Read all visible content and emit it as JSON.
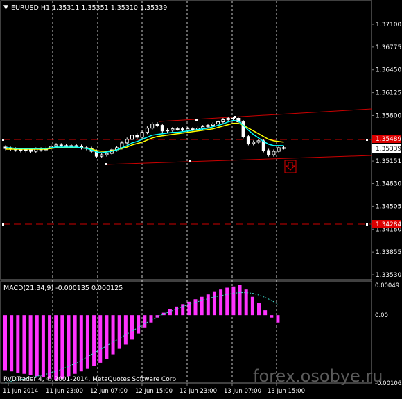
{
  "symbol_header": "EURUSD,H1  1.35311 1.35351 1.35310 1.35339",
  "price_axis": {
    "ticks": [
      "1.37100",
      "1.36775",
      "1.36450",
      "1.36125",
      "1.35800",
      "1.35489",
      "1.35339",
      "1.35151",
      "1.34830",
      "1.34505",
      "1.34180",
      "1.33855",
      "1.33530"
    ],
    "range": [
      1.3353,
      1.3718
    ],
    "current_price_label": "1.35339",
    "marker_label": "1.35489",
    "bottom_marker_label": "1.34284"
  },
  "indicator": {
    "label": "MACD(21,34,9) -0.000135 0.000125",
    "axis_ticks": [
      "0.00049",
      "0.00",
      "-0.001065"
    ]
  },
  "time_axis": [
    "11 Jun 2014",
    "11 Jun 23:00",
    "12 Jun 07:00",
    "12 Jun 15:00",
    "12 Jun 23:00",
    "13 Jun 07:00",
    "13 Jun 15:00"
  ],
  "copyright": "RVDTrader 4, © 2001-2014, MetaQuotes Software Corp.",
  "watermark": "forex.osobye.ru",
  "colors": {
    "background": "#000000",
    "axis_text": "#ffffff",
    "candle": "#ffffff",
    "channel": "#cc0000",
    "ma_yellow": "#ffff00",
    "ma_cyan": "#00ffff",
    "macd_hist": "#ff33ff",
    "signal": "#40e0d0",
    "marker_red": "#dd0000"
  },
  "chart_data": {
    "type": "line",
    "series_candles": {
      "open": [
        1.3535,
        1.3533,
        1.3532,
        1.3531,
        1.353,
        1.3531,
        1.3529,
        1.3532,
        1.3531,
        1.3533,
        1.3536,
        1.3538,
        1.3537,
        1.3536,
        1.3537,
        1.3536,
        1.3534,
        1.3533,
        1.3529,
        1.3522,
        1.3524,
        1.3526,
        1.3531,
        1.3534,
        1.3541,
        1.3546,
        1.3552,
        1.3549,
        1.3556,
        1.3562,
        1.3568,
        1.3566,
        1.3558,
        1.3559,
        1.3561,
        1.3561,
        1.3559,
        1.3561,
        1.356,
        1.3562,
        1.3564,
        1.3566,
        1.3568,
        1.3571,
        1.3574,
        1.3576,
        1.3576,
        1.3571,
        1.355,
        1.354,
        1.3542,
        1.3544,
        1.353,
        1.3524,
        1.3529,
        1.3534
      ],
      "close": [
        1.3533,
        1.3532,
        1.3531,
        1.353,
        1.3531,
        1.3529,
        1.3532,
        1.3531,
        1.3533,
        1.3536,
        1.3538,
        1.3537,
        1.3536,
        1.3537,
        1.3536,
        1.3534,
        1.3533,
        1.3529,
        1.3522,
        1.3524,
        1.3526,
        1.3531,
        1.3534,
        1.3541,
        1.3546,
        1.3552,
        1.3549,
        1.3556,
        1.3562,
        1.3568,
        1.3566,
        1.3558,
        1.3559,
        1.3561,
        1.3561,
        1.3559,
        1.3561,
        1.356,
        1.3562,
        1.3564,
        1.3566,
        1.3568,
        1.3571,
        1.3574,
        1.3576,
        1.3576,
        1.3571,
        1.355,
        1.354,
        1.3542,
        1.3544,
        1.353,
        1.3524,
        1.3529,
        1.3534,
        1.3534
      ]
    },
    "ma_yellow": [
      1.3532,
      1.3532,
      1.3532,
      1.3532,
      1.3532,
      1.3532,
      1.3532,
      1.3532,
      1.3532,
      1.3533,
      1.3534,
      1.3534,
      1.3534,
      1.3534,
      1.3534,
      1.3534,
      1.3533,
      1.3532,
      1.353,
      1.3529,
      1.3529,
      1.353,
      1.3531,
      1.3533,
      1.3535,
      1.3538,
      1.354,
      1.3542,
      1.3545,
      1.3548,
      1.355,
      1.3551,
      1.3552,
      1.3553,
      1.3554,
      1.3555,
      1.3556,
      1.3557,
      1.3558,
      1.3559,
      1.356,
      1.3561,
      1.3563,
      1.3565,
      1.3567,
      1.3569,
      1.3569,
      1.3566,
      1.3562,
      1.3558,
      1.3554,
      1.355,
      1.3546,
      1.3544,
      1.3543,
      1.3542
    ],
    "ma_cyan": [
      1.3534,
      1.3534,
      1.3533,
      1.3533,
      1.3533,
      1.3533,
      1.3533,
      1.3533,
      1.3533,
      1.3534,
      1.3535,
      1.3535,
      1.3535,
      1.3535,
      1.3535,
      1.3534,
      1.3533,
      1.3531,
      1.3528,
      1.3527,
      1.3528,
      1.3529,
      1.3531,
      1.3534,
      1.3537,
      1.3541,
      1.3543,
      1.3546,
      1.3549,
      1.3552,
      1.3553,
      1.3554,
      1.3555,
      1.3556,
      1.3556,
      1.3557,
      1.3558,
      1.3559,
      1.356,
      1.3561,
      1.3562,
      1.3564,
      1.3566,
      1.3568,
      1.3571,
      1.3573,
      1.3572,
      1.3566,
      1.3559,
      1.3553,
      1.3548,
      1.3543,
      1.3539,
      1.3537,
      1.3537,
      1.3537
    ],
    "macd_hist": [
      -0.0009,
      -0.00092,
      -0.00094,
      -0.00096,
      -0.00098,
      -0.001,
      -0.00102,
      -0.00104,
      -0.00106,
      -0.00104,
      -0.001,
      -0.00096,
      -0.00092,
      -0.00088,
      -0.00083,
      -0.00078,
      -0.00072,
      -0.00064,
      -0.00055,
      -0.00048,
      -0.0004,
      -0.0003,
      -0.0002,
      -0.00012,
      -4e-05,
      4e-05,
      0.0001,
      0.00014,
      0.00018,
      0.00022,
      0.00026,
      0.0003,
      0.00034,
      0.00038,
      0.00042,
      0.00045,
      0.00047,
      0.00049,
      0.00042,
      0.0003,
      0.0002,
      8e-05,
      -4e-05,
      -0.00012
    ],
    "macd_signal": [
      -0.0011,
      -0.00108,
      -0.00106,
      -0.00104,
      -0.00102,
      -0.001,
      -0.00098,
      -0.00095,
      -0.00092,
      -0.00088,
      -0.00084,
      -0.00079,
      -0.00074,
      -0.00068,
      -0.00062,
      -0.00056,
      -0.0005,
      -0.00044,
      -0.00038,
      -0.00032,
      -0.00026,
      -0.0002,
      -0.00014,
      -8e-05,
      -3e-05,
      2e-05,
      6e-05,
      0.0001,
      0.00014,
      0.00018,
      0.00021,
      0.00024,
      0.00027,
      0.0003,
      0.00032,
      0.00034,
      0.00036,
      0.00037,
      0.00037,
      0.00036,
      0.00033,
      0.00029,
      0.00024,
      0.00018
    ],
    "xlabel": "",
    "ylabel": ""
  }
}
